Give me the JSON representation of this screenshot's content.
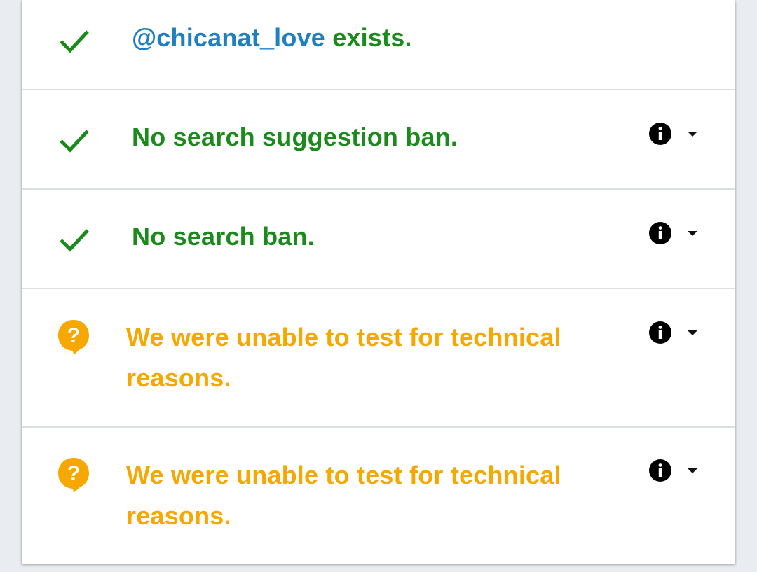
{
  "rows": [
    {
      "status": "ok",
      "icon": "check-icon",
      "handle": "@chicanat_love",
      "text": " exists.",
      "has_details": false
    },
    {
      "status": "ok",
      "icon": "check-icon",
      "text": "No search suggestion ban.",
      "has_details": true
    },
    {
      "status": "ok",
      "icon": "check-icon",
      "text": "No search ban.",
      "has_details": true
    },
    {
      "status": "warn",
      "icon": "question-bubble-icon",
      "text_line1": "We were unable to test for technical",
      "text_line2": "reasons.",
      "has_details": true
    },
    {
      "status": "warn",
      "icon": "question-bubble-icon",
      "text_line1": "We were unable to test for technical",
      "text_line2": "reasons.",
      "has_details": true
    }
  ],
  "colors": {
    "ok": "#1a8a1a",
    "warn": "#f6a700",
    "handle": "#1f7fc0",
    "divider": "#dcdfe3"
  }
}
